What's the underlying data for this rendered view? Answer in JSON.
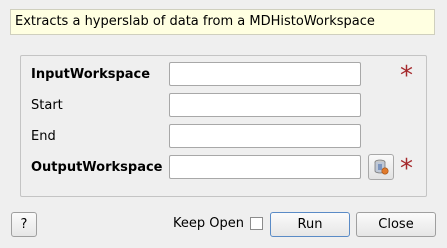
{
  "description": "Extracts a hyperslab of data from a MDHistoWorkspace",
  "properties": [
    {
      "label": "InputWorkspace",
      "bold": true,
      "value": "",
      "required": true,
      "browse": false
    },
    {
      "label": "Start",
      "bold": false,
      "value": "",
      "required": false,
      "browse": false
    },
    {
      "label": "End",
      "bold": false,
      "value": "",
      "required": false,
      "browse": false
    },
    {
      "label": "OutputWorkspace",
      "bold": true,
      "value": "",
      "required": true,
      "browse": true
    }
  ],
  "required_marker": "*",
  "buttons": {
    "help": "?",
    "keep_open": "Keep Open",
    "keep_open_checked": false,
    "run": "Run",
    "close": "Close"
  },
  "colors": {
    "required_star": "#a5292c",
    "description_bg": "#ffffe1",
    "window_bg": "#efefef",
    "default_button_border": "#5a8bc6"
  },
  "icons": {
    "browse": "save-workspace-icon"
  }
}
